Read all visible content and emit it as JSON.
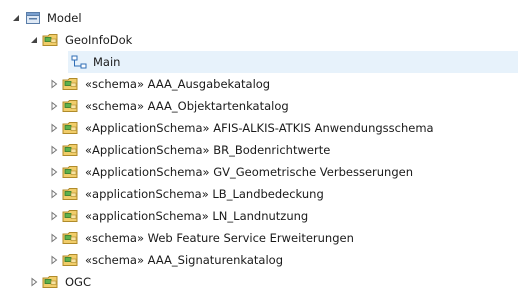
{
  "tree": {
    "model": {
      "label": "Model"
    },
    "geoinfodok": {
      "label": "GeoInfoDok"
    },
    "main": {
      "label": "Main"
    },
    "packages": [
      {
        "label": "«schema» AAA_Ausgabekatalog"
      },
      {
        "label": "«schema» AAA_Objektartenkatalog"
      },
      {
        "label": "«ApplicationSchema» AFIS-ALKIS-ATKIS Anwendungsschema"
      },
      {
        "label": "«ApplicationSchema» BR_Bodenrichtwerte"
      },
      {
        "label": "«ApplicationSchema» GV_Geometrische Verbesserungen"
      },
      {
        "label": "«applicationSchema» LB_Landbedeckung"
      },
      {
        "label": "«applicationSchema» LN_Landnutzung"
      },
      {
        "label": "«schema» Web Feature Service Erweiterungen"
      },
      {
        "label": "«schema» AAA_Signaturenkatalog"
      }
    ],
    "ogc": {
      "label": "OGC"
    }
  },
  "icons": {
    "expanded": "triangle-down-icon",
    "collapsed": "triangle-right-icon",
    "model": "model-folder-icon",
    "package": "package-folder-icon",
    "diagram": "diagram-icon"
  },
  "colors": {
    "selection": "#e7f2fb",
    "package_folder": "#e8b94a",
    "package_tab": "#3b9a3b",
    "diagram": "#2f6db5"
  }
}
